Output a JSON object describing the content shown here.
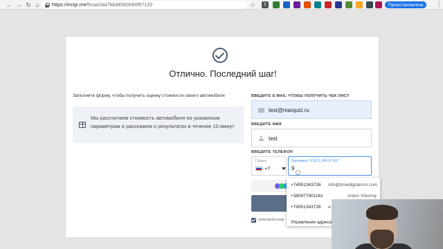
{
  "browser": {
    "url_host": "https://mrqz.me/",
    "url_path": "5caa1ba7bbd4560044f67120",
    "paused_label": "Приостановлена"
  },
  "card": {
    "title": "Отлично. Последний шаг!",
    "left_label": "Заполните форму, чтобы получить оценку стоимости своего автомобиля",
    "info_text": "Мы рассчитаем стоимость автомобиля по указанным параметрам и расскажем о результатах в течение 10 минут"
  },
  "form": {
    "email_label": "ВВЕДИТЕ E-MAIL ЧТОБЫ ПОЛУЧИТЬ ЧЕК-ЛИСТ",
    "email_value": "test@marquiz.ru",
    "name_label": "ВВЕДИТЕ ИМЯ",
    "name_value": "test",
    "phone_label": "ВВЕДИТЕ ТЕЛЕФОН",
    "country_label": "Страна",
    "country_code": "+7",
    "phone_hint": "Например: 8 (912) 345-67-89 *",
    "phone_value": "9",
    "consent_text": "политикой конф"
  },
  "autofill": {
    "items": [
      {
        "number": "+74951343726",
        "detail": "info@timedigitalcrm.com"
      },
      {
        "number": "+380977901161",
        "detail": "Anton Viborniy"
      },
      {
        "number": "+74951343726",
        "detail": "а"
      }
    ],
    "manage_label": "Управление адресами"
  },
  "colors": {
    "accent": "#4a5b70",
    "submit": "#5c6f88",
    "phone_focus": "#4a90e2",
    "paused": "#1a73e8"
  }
}
